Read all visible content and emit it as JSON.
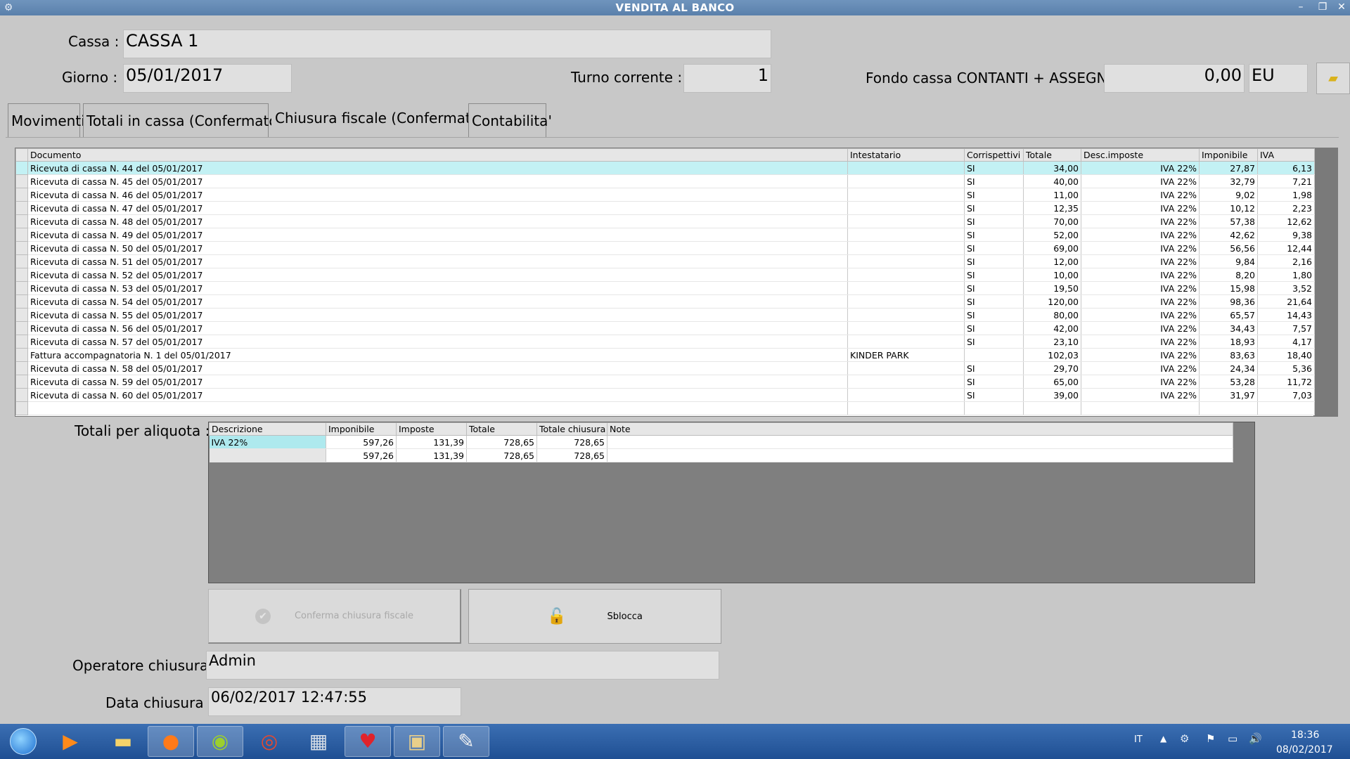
{
  "window": {
    "title": "VENDITA AL BANCO",
    "controls": {
      "minimize": "–",
      "restore": "❐",
      "close": "✕"
    }
  },
  "header": {
    "cassa_label": "Cassa :",
    "cassa_value": "CASSA 1",
    "giorno_label": "Giorno :",
    "giorno_value": "05/01/2017",
    "turno_label": "Turno corrente :",
    "turno_value": "1",
    "fondo_label": "Fondo cassa CONTANTI + ASSEGNI :",
    "fondo_value": "0,00",
    "fondo_currency": "EU"
  },
  "tabs": [
    {
      "label": "Movimenti"
    },
    {
      "label": "Totali in cassa (Confermato)"
    },
    {
      "label": "Chiusura fiscale (Confermato)"
    },
    {
      "label": "Contabilita'"
    }
  ],
  "documents": {
    "columns": [
      "Documento",
      "Intestatario",
      "Corrispettivi",
      "Totale",
      "Desc.imposte",
      "Imponibile",
      "IVA"
    ],
    "rows": [
      [
        "Ricevuta di cassa N. 44 del 05/01/2017",
        "",
        "SI",
        "34,00",
        "IVA 22%",
        "27,87",
        "6,13"
      ],
      [
        "Ricevuta di cassa N. 45 del 05/01/2017",
        "",
        "SI",
        "40,00",
        "IVA 22%",
        "32,79",
        "7,21"
      ],
      [
        "Ricevuta di cassa N. 46 del 05/01/2017",
        "",
        "SI",
        "11,00",
        "IVA 22%",
        "9,02",
        "1,98"
      ],
      [
        "Ricevuta di cassa N. 47 del 05/01/2017",
        "",
        "SI",
        "12,35",
        "IVA 22%",
        "10,12",
        "2,23"
      ],
      [
        "Ricevuta di cassa N. 48 del 05/01/2017",
        "",
        "SI",
        "70,00",
        "IVA 22%",
        "57,38",
        "12,62"
      ],
      [
        "Ricevuta di cassa N. 49 del 05/01/2017",
        "",
        "SI",
        "52,00",
        "IVA 22%",
        "42,62",
        "9,38"
      ],
      [
        "Ricevuta di cassa N. 50 del 05/01/2017",
        "",
        "SI",
        "69,00",
        "IVA 22%",
        "56,56",
        "12,44"
      ],
      [
        "Ricevuta di cassa N. 51 del 05/01/2017",
        "",
        "SI",
        "12,00",
        "IVA 22%",
        "9,84",
        "2,16"
      ],
      [
        "Ricevuta di cassa N. 52 del 05/01/2017",
        "",
        "SI",
        "10,00",
        "IVA 22%",
        "8,20",
        "1,80"
      ],
      [
        "Ricevuta di cassa N. 53 del 05/01/2017",
        "",
        "SI",
        "19,50",
        "IVA 22%",
        "15,98",
        "3,52"
      ],
      [
        "Ricevuta di cassa N. 54 del 05/01/2017",
        "",
        "SI",
        "120,00",
        "IVA 22%",
        "98,36",
        "21,64"
      ],
      [
        "Ricevuta di cassa N. 55 del 05/01/2017",
        "",
        "SI",
        "80,00",
        "IVA 22%",
        "65,57",
        "14,43"
      ],
      [
        "Ricevuta di cassa N. 56 del 05/01/2017",
        "",
        "SI",
        "42,00",
        "IVA 22%",
        "34,43",
        "7,57"
      ],
      [
        "Ricevuta di cassa N. 57 del 05/01/2017",
        "",
        "SI",
        "23,10",
        "IVA 22%",
        "18,93",
        "4,17"
      ],
      [
        "Fattura accompagnatoria N. 1 del 05/01/2017",
        "KINDER PARK",
        "",
        "102,03",
        "IVA 22%",
        "83,63",
        "18,40"
      ],
      [
        "Ricevuta di cassa N. 58 del 05/01/2017",
        "",
        "SI",
        "29,70",
        "IVA 22%",
        "24,34",
        "5,36"
      ],
      [
        "Ricevuta di cassa N. 59 del 05/01/2017",
        "",
        "SI",
        "65,00",
        "IVA 22%",
        "53,28",
        "11,72"
      ],
      [
        "Ricevuta di cassa N. 60 del 05/01/2017",
        "",
        "SI",
        "39,00",
        "IVA 22%",
        "31,97",
        "7,03"
      ]
    ]
  },
  "totali": {
    "label": "Totali per aliquota :",
    "columns": [
      "Descrizione",
      "Imponibile",
      "Imposte",
      "Totale",
      "Totale chiusura",
      "Note"
    ],
    "rows": [
      [
        "IVA 22%",
        "597,26",
        "131,39",
        "728,65",
        "728,65",
        ""
      ],
      [
        "",
        "597,26",
        "131,39",
        "728,65",
        "728,65",
        ""
      ]
    ]
  },
  "buttons": {
    "conferma": "Conferma chiusura fiscale",
    "sblocca": "Sblocca"
  },
  "chiusura": {
    "operatore_label": "Operatore chiusura :",
    "operatore_value": "Admin",
    "data_label": "Data chiusura :",
    "data_value": "06/02/2017 12:47:55"
  },
  "taskbar": {
    "language": "IT",
    "time": "18:36",
    "date": "08/02/2017",
    "apps": [
      "media-player",
      "file-explorer",
      "firefox",
      "app-green",
      "chrome",
      "calculator",
      "strawberry-app",
      "photo-viewer",
      "paint"
    ]
  },
  "colors": {
    "titlebar": "#5f86b2",
    "selection": "#aee9ee",
    "taskbar": "#2b5ea2"
  }
}
